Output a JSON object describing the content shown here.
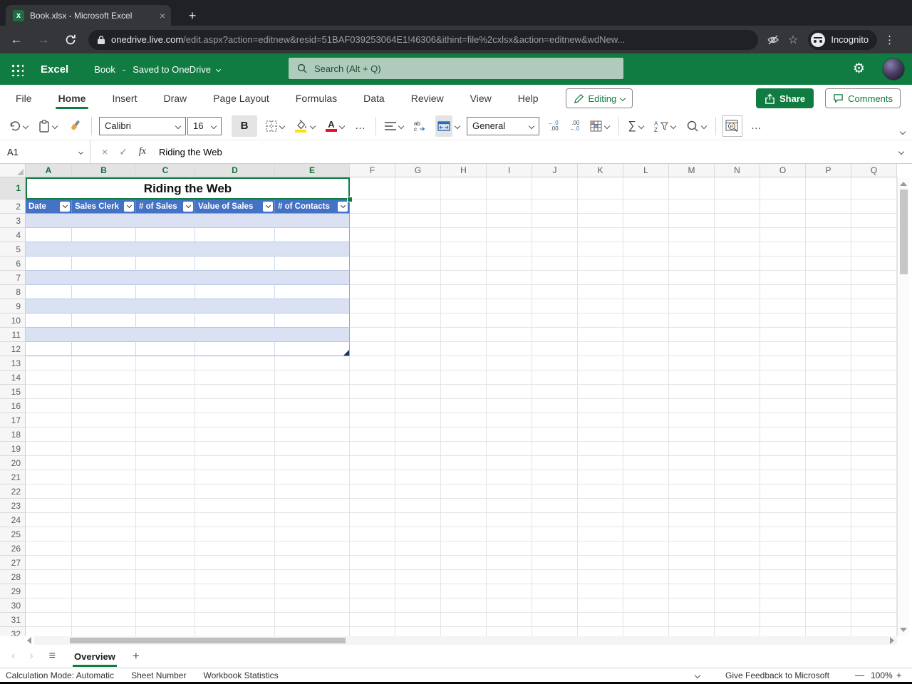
{
  "browser": {
    "tab_title": "Book.xlsx - Microsoft Excel",
    "close_label": "×",
    "new_tab_label": "+",
    "url_domain": "onedrive.live.com",
    "url_path": "/edit.aspx?action=editnew&resid=51BAF039253064E1!46306&ithint=file%2cxlsx&action=editnew&wdNew...",
    "incognito_label": "Incognito"
  },
  "icons": {
    "back": "←",
    "forward": "→",
    "star": "☆",
    "kebab": "⋮",
    "gear": "⚙",
    "hamburger": "≡",
    "prev_sheet": "‹",
    "next_sheet": "›"
  },
  "app_header": {
    "app_name": "Excel",
    "doc_name": "Book",
    "separator": "-",
    "save_status": "Saved to OneDrive",
    "search_placeholder": "Search (Alt + Q)"
  },
  "ribbon": {
    "tabs": [
      "File",
      "Home",
      "Insert",
      "Draw",
      "Page Layout",
      "Formulas",
      "Data",
      "Review",
      "View",
      "Help"
    ],
    "active_tab": "Home",
    "editing_label": "Editing",
    "share_label": "Share",
    "comments_label": "Comments"
  },
  "toolbar": {
    "font_name": "Calibri",
    "font_size": "16",
    "bold_label": "B",
    "font_color_label": "A",
    "number_format": "General",
    "increase_decimal_top": "←.0",
    "increase_decimal_bottom": ".00",
    "decrease_decimal_top": ".00",
    "decrease_decimal_bottom": "→.0",
    "sum_label": "∑",
    "sort_a": "A",
    "sort_z": "Z",
    "more_label": "…"
  },
  "formula_bar": {
    "name_box": "A1",
    "cancel_label": "×",
    "enter_label": "✓",
    "fx_label": "fx",
    "content": "Riding the Web"
  },
  "grid": {
    "column_letters": [
      "A",
      "B",
      "C",
      "D",
      "E",
      "F",
      "G",
      "H",
      "I",
      "J",
      "K",
      "L",
      "M",
      "N",
      "O",
      "P",
      "Q"
    ],
    "selected_columns": [
      "A",
      "B",
      "C",
      "D",
      "E"
    ],
    "row_count": 32,
    "selected_rows": [
      1
    ],
    "title_cell": {
      "ref": "A1",
      "text": "Riding the Web"
    },
    "table": {
      "header_row": 2,
      "first_data_row": 3,
      "last_data_row": 12,
      "headers": [
        "Date",
        "Sales Clerk",
        "# of Sales",
        "Value of Sales",
        "# of Contacts"
      ]
    }
  },
  "sheet_bar": {
    "active_sheet": "Overview",
    "add_label": "+"
  },
  "status_bar": {
    "items": [
      "Calculation Mode: Automatic",
      "Sheet Number",
      "Workbook Statistics"
    ],
    "feedback_label": "Give Feedback to Microsoft",
    "zoom_out": "—",
    "zoom_level": "100%",
    "zoom_in": "+"
  },
  "colors": {
    "excel_green": "#107C41",
    "table_header_blue": "#4472C4",
    "band_blue": "#D9E1F2",
    "table_border_blue": "#8EA9DB"
  }
}
